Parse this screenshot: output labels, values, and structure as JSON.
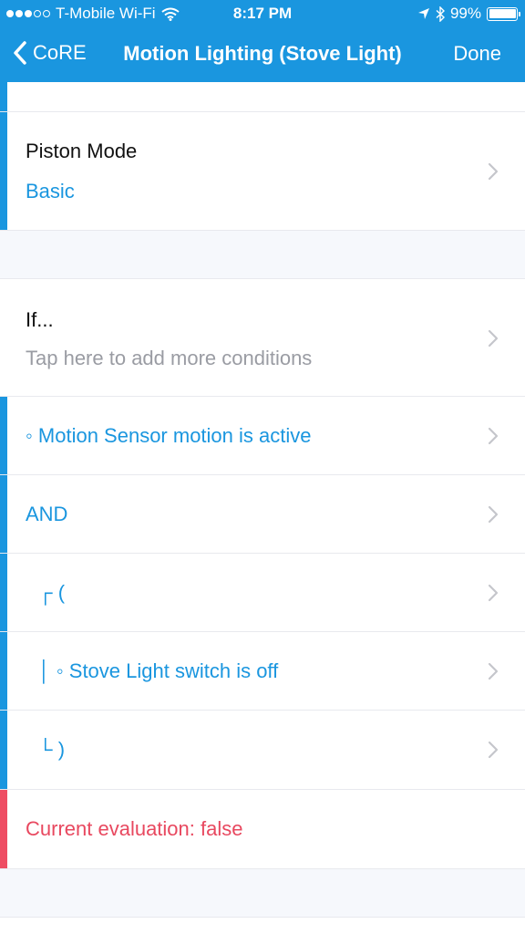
{
  "status": {
    "carrier": "T-Mobile Wi-Fi",
    "time": "8:17 PM",
    "battery": "99%"
  },
  "nav": {
    "back_label": "CoRE",
    "title": "Motion Lighting (Stove Light)",
    "done_label": "Done"
  },
  "piston_mode": {
    "label": "Piston Mode",
    "value": "Basic"
  },
  "if_section": {
    "title": "If...",
    "hint": "Tap here to add more conditions"
  },
  "conditions": [
    "◦ Motion Sensor motion is active",
    "AND",
    "┌ (",
    "│  ◦ Stove Light switch is off",
    "└ )"
  ],
  "evaluation": "Current evaluation: false",
  "colors": {
    "accent": "#1a96df",
    "error": "#e8485f",
    "background": "#f6f8fc"
  }
}
